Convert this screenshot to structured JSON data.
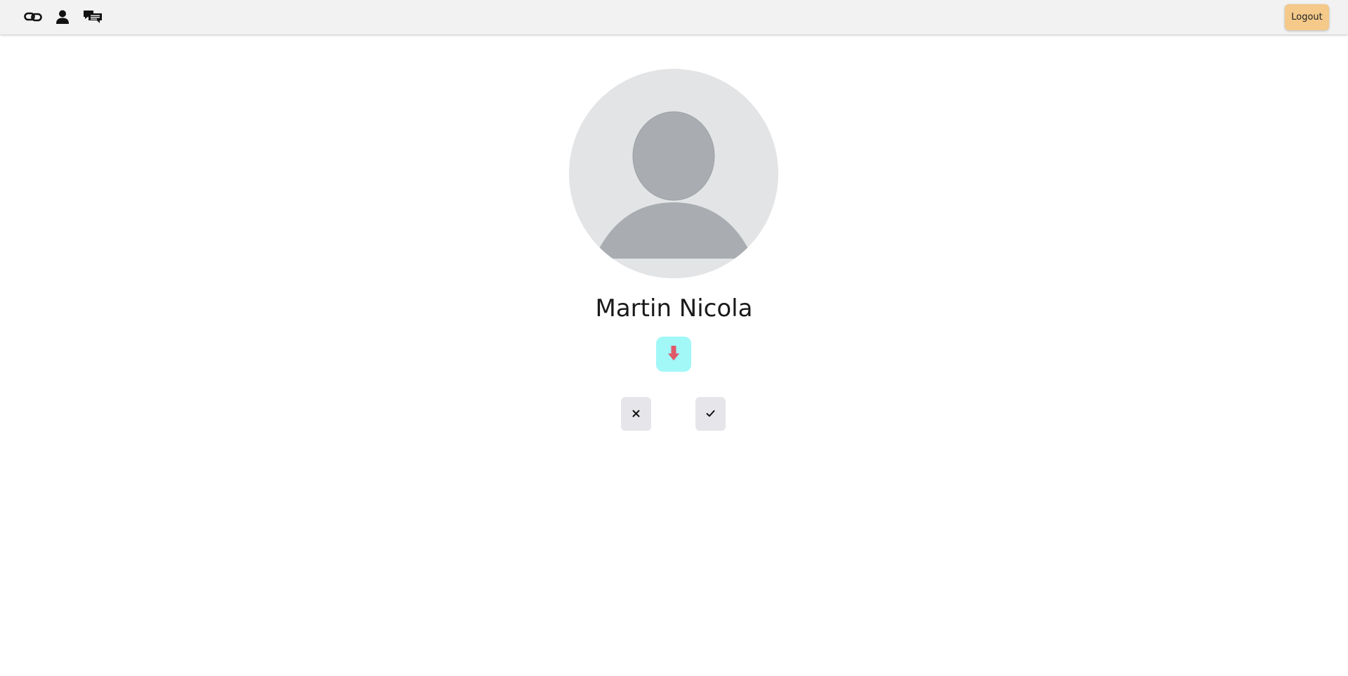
{
  "navbar": {
    "icons": [
      "link-icon",
      "user-icon",
      "chat-icon"
    ],
    "logout_label": "Logout",
    "logout_color": "#f4c98a"
  },
  "profile": {
    "name": "Martin Nicola",
    "avatar": "default-avatar-icon"
  },
  "actions": {
    "download_icon": "arrow-down-icon",
    "download_bg": "#a2f7f7",
    "download_arrow_color": "#e05a6a",
    "reject_icon": "close-icon",
    "accept_icon": "check-icon"
  }
}
